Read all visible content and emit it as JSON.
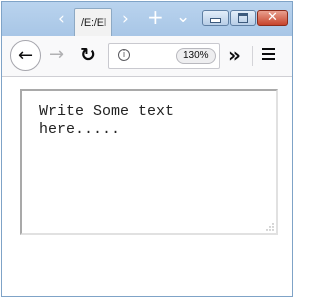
{
  "window": {
    "tab_title": "/E:/El",
    "nav_back_glyph": "‹",
    "nav_forward_glyph": "›",
    "new_tab_glyph": "+",
    "tab_list_glyph": "⌄",
    "controls": {
      "minimize_icon": "minimize-icon",
      "maximize_icon": "maximize-icon",
      "close_icon": "close-icon",
      "close_glyph": "✕",
      "close_color": "#c7442c"
    }
  },
  "toolbar": {
    "back_glyph": "←",
    "forward_glyph": "→",
    "reload_glyph": "↻",
    "info_glyph": "i",
    "zoom_level": "130%",
    "overflow_glyph": "»",
    "menu_icon": "hamburger-menu-icon"
  },
  "page": {
    "textarea_text": "Write Some text here....."
  },
  "colors": {
    "titlebar": "#b9d3ee",
    "toolbar": "#f9f9fa",
    "textarea_border": "#a9a9a9"
  }
}
